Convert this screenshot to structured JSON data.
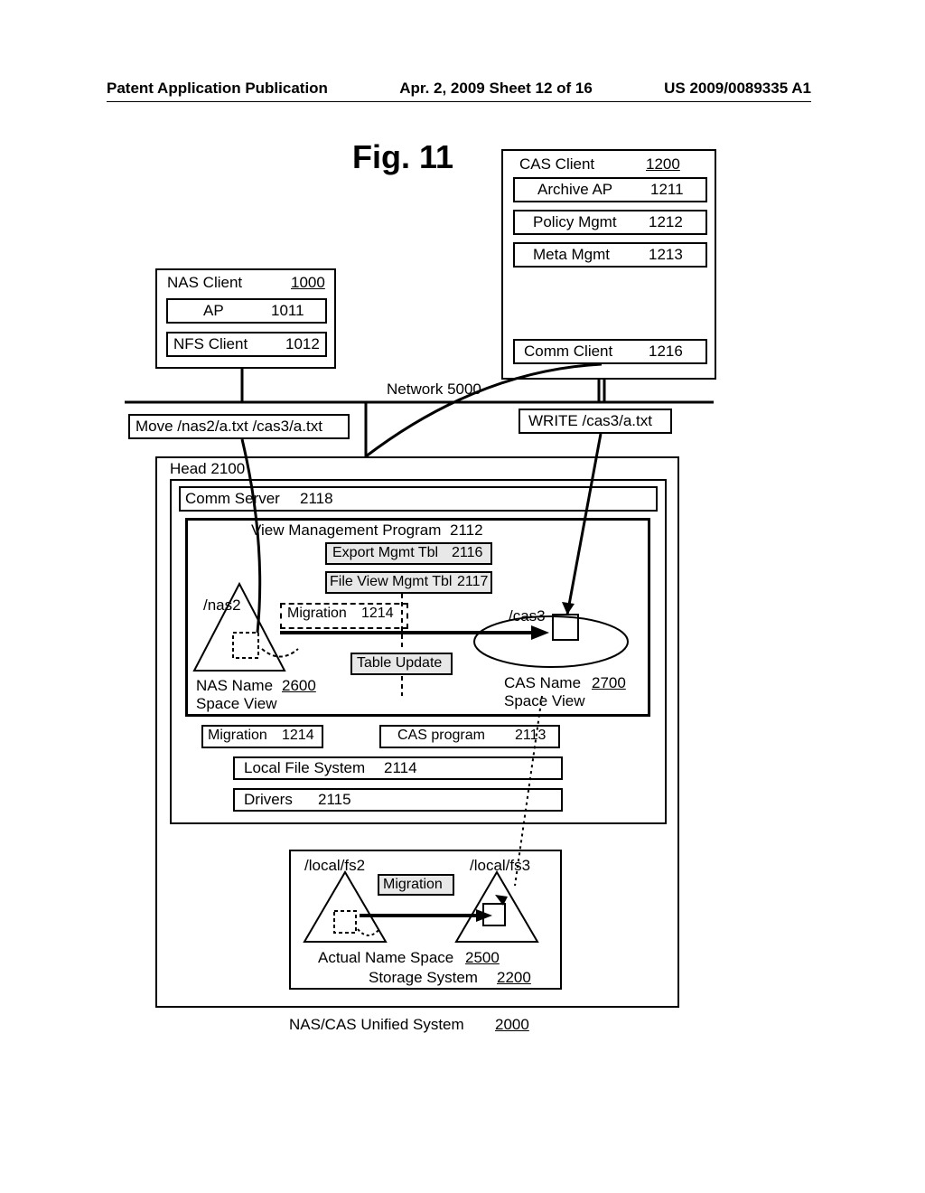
{
  "header": {
    "left": "Patent Application Publication",
    "mid": "Apr. 2, 2009  Sheet 12 of 16",
    "right": "US 2009/0089335 A1"
  },
  "fig_title": "Fig. 11",
  "cas_client": {
    "title": "CAS Client",
    "id": "1200",
    "archive": "Archive AP",
    "archive_id": "1211",
    "policy": "Policy Mgmt",
    "policy_id": "1212",
    "meta": "Meta Mgmt",
    "meta_id": "1213",
    "comm": "Comm Client",
    "comm_id": "1216"
  },
  "nas_client": {
    "title": "NAS Client",
    "id": "1000",
    "ap": "AP",
    "ap_id": "1011",
    "nfs": "NFS Client",
    "nfs_id": "1012"
  },
  "network": "Network 5000",
  "move_cmd": "Move /nas2/a.txt /cas3/a.txt",
  "write_cmd": "WRITE /cas3/a.txt",
  "head": {
    "title": "Head 2100",
    "comm_server": "Comm Server",
    "comm_server_id": "2118",
    "view_prog": "View Management Program",
    "view_prog_id": "2112",
    "export_tbl": "Export Mgmt Tbl",
    "export_tbl_id": "2116",
    "file_view_tbl": "File View Mgmt Tbl",
    "file_view_tbl_id": "2117",
    "nas2": "/nas2",
    "cas3": "/cas3",
    "migration": "Migration",
    "migration_id": "1214",
    "nas_space": "NAS Name",
    "nas_space_id": "2600",
    "nas_space2": "Space View",
    "cas_space": "CAS Name",
    "cas_space_id": "2700",
    "cas_space2": "Space View",
    "table_update": "Table Update",
    "migration2": "Migration",
    "migration2_id": "1214",
    "cas_prog": "CAS program",
    "cas_prog_id": "2113",
    "local_fs": "Local File System",
    "local_fs_id": "2114",
    "drivers": "Drivers",
    "drivers_id": "2115"
  },
  "storage": {
    "fs2": "/local/fs2",
    "fs3": "/local/fs3",
    "migration": "Migration",
    "actual": "Actual Name Space",
    "actual_id": "2500",
    "system": "Storage System",
    "system_id": "2200"
  },
  "unified": "NAS/CAS Unified System",
  "unified_id": "2000"
}
